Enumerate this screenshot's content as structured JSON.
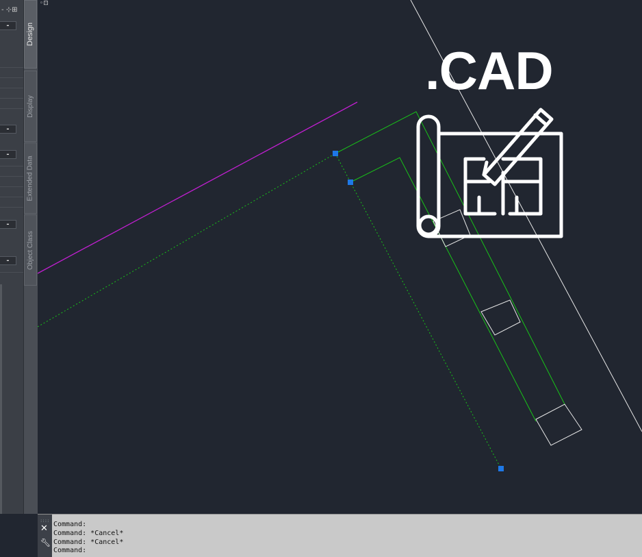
{
  "palette": {
    "collapse_buttons": [
      "-",
      "-",
      "-",
      "-",
      "-"
    ]
  },
  "tabs": [
    {
      "label": "Design",
      "active": true
    },
    {
      "label": "Display",
      "active": false
    },
    {
      "label": "Extended Data",
      "active": false
    },
    {
      "label": "Object Class",
      "active": false
    }
  ],
  "logo": {
    "text": ".CAD",
    "icon": "blueprint-pencil-icon"
  },
  "command_line": {
    "history": [
      "Command:",
      "Command: *Cancel*",
      "Command: *Cancel*",
      "Command:"
    ],
    "close_icon": "close-icon",
    "settings_icon": "wrench-icon"
  },
  "colors": {
    "background": "#212630",
    "magenta_line": "#c21fd2",
    "green_line": "#18c318",
    "grip": "#1e78e6",
    "white_line": "#e8e8e8"
  }
}
